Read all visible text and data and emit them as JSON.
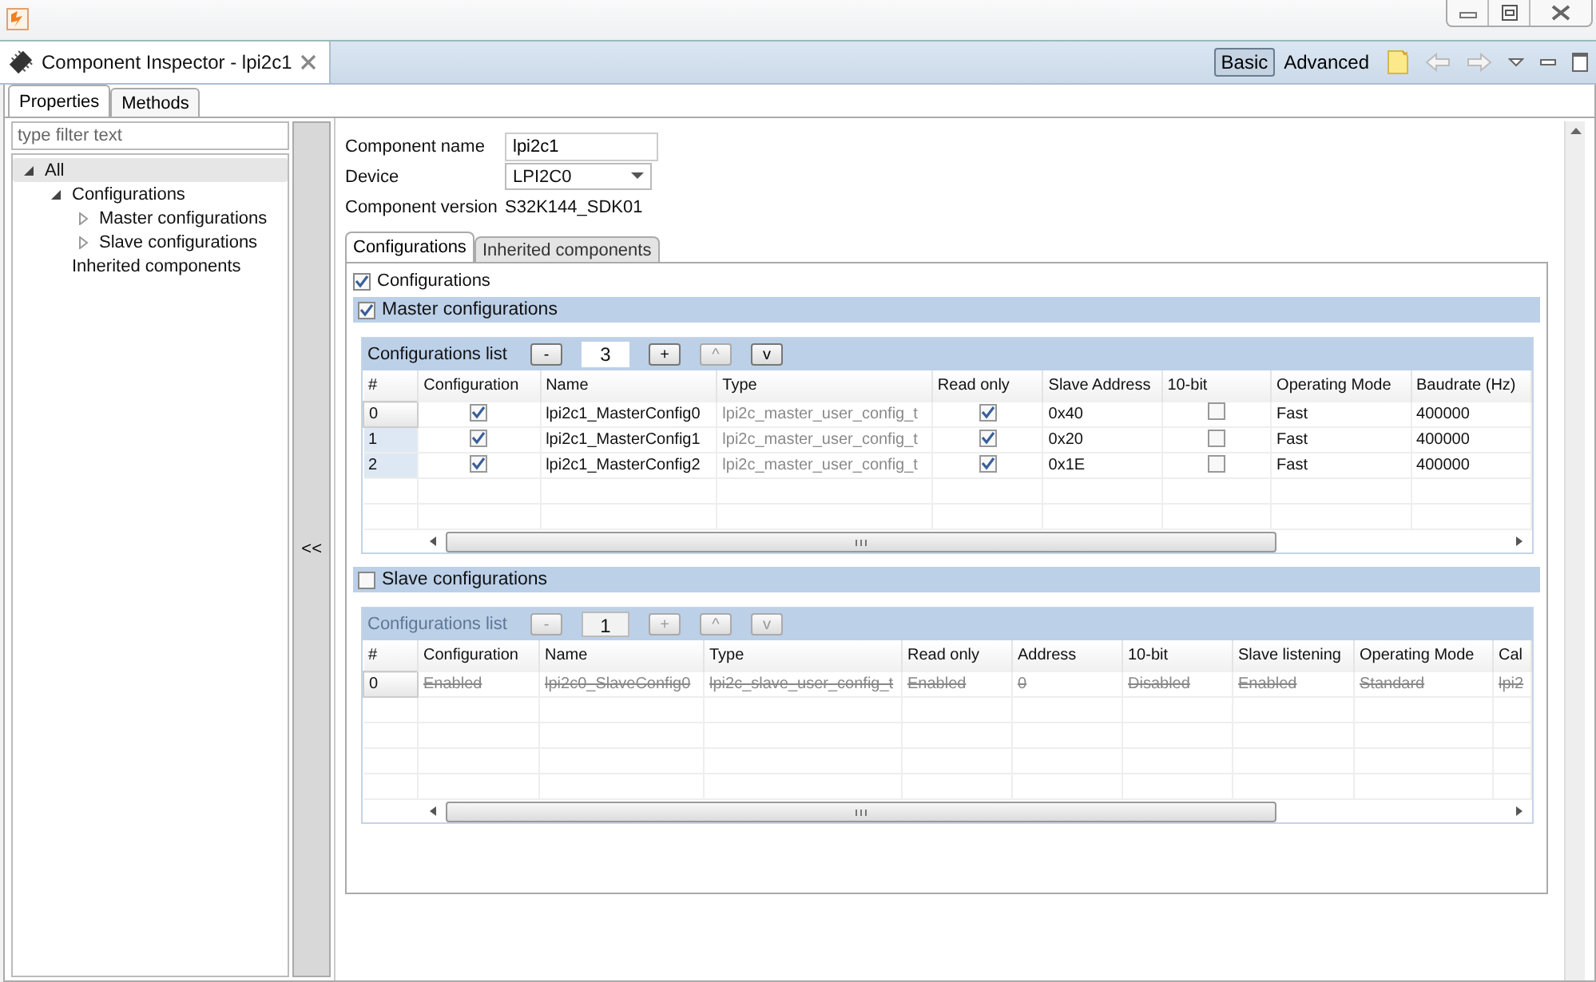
{
  "editor_tab": {
    "title": "Component Inspector - lpi2c1"
  },
  "view_modes": [
    {
      "label": "Basic",
      "selected": true
    },
    {
      "label": "Advanced",
      "selected": false
    }
  ],
  "side_tabs": [
    {
      "label": "Properties",
      "selected": true
    },
    {
      "label": "Methods",
      "selected": false
    }
  ],
  "filter": {
    "placeholder": "type filter text"
  },
  "tree": [
    {
      "label": "All",
      "expanded": true,
      "selected": true,
      "children": [
        {
          "label": "Configurations",
          "expanded": true,
          "selected": false,
          "children": [
            {
              "label": "Master configurations",
              "expanded": false,
              "selected": false
            },
            {
              "label": "Slave configurations",
              "expanded": false,
              "selected": false
            }
          ]
        },
        {
          "label": "Inherited components",
          "selected": false
        }
      ]
    }
  ],
  "collapse_button": "<<",
  "form": [
    {
      "kind": "input",
      "label": "Component name",
      "value": "lpi2c1"
    },
    {
      "kind": "dropdown",
      "label": "Device",
      "value": "LPI2C0"
    },
    {
      "kind": "text",
      "label": "Component version",
      "value": "S32K144_SDK01"
    }
  ],
  "inner_tabs": [
    {
      "label": "Configurations",
      "selected": true
    },
    {
      "label": "Inherited components",
      "selected": false
    }
  ],
  "configurations": {
    "label": "Configurations",
    "checked": true
  },
  "sections": [
    {
      "title": "Master configurations",
      "checked": true,
      "disabled": false,
      "list_label": "Configurations list",
      "count": "3",
      "buttons": [
        {
          "label": "-",
          "disabled": false
        },
        {
          "label": "+",
          "disabled": false
        },
        {
          "label": "^",
          "disabled": true
        },
        {
          "label": "v",
          "disabled": false
        }
      ],
      "columns": [
        "#",
        "Configuration",
        "Name",
        "Type",
        "Read only",
        "Slave Address",
        "10-bit",
        "Operating Mode",
        "Baudrate (Hz)"
      ],
      "rows": [
        [
          {
            "kind": "index",
            "value": "0"
          },
          {
            "kind": "check",
            "checked": true
          },
          {
            "kind": "text",
            "value": "lpi2c1_MasterConfig0"
          },
          {
            "kind": "dim",
            "value": "lpi2c_master_user_config_t"
          },
          {
            "kind": "check",
            "checked": true
          },
          {
            "kind": "text",
            "value": "0x40"
          },
          {
            "kind": "check",
            "checked": false
          },
          {
            "kind": "text",
            "value": "Fast"
          },
          {
            "kind": "text",
            "value": "400000"
          }
        ],
        [
          {
            "kind": "index",
            "value": "1"
          },
          {
            "kind": "check",
            "checked": true
          },
          {
            "kind": "text",
            "value": "lpi2c1_MasterConfig1"
          },
          {
            "kind": "dim",
            "value": "lpi2c_master_user_config_t"
          },
          {
            "kind": "check",
            "checked": true
          },
          {
            "kind": "text",
            "value": "0x20"
          },
          {
            "kind": "check",
            "checked": false
          },
          {
            "kind": "text",
            "value": "Fast"
          },
          {
            "kind": "text",
            "value": "400000"
          }
        ],
        [
          {
            "kind": "index",
            "value": "2"
          },
          {
            "kind": "check",
            "checked": true
          },
          {
            "kind": "text",
            "value": "lpi2c1_MasterConfig2"
          },
          {
            "kind": "dim",
            "value": "lpi2c_master_user_config_t"
          },
          {
            "kind": "check",
            "checked": true
          },
          {
            "kind": "text",
            "value": "0x1E"
          },
          {
            "kind": "check",
            "checked": false
          },
          {
            "kind": "text",
            "value": "Fast"
          },
          {
            "kind": "text",
            "value": "400000"
          }
        ]
      ]
    },
    {
      "title": "Slave configurations",
      "checked": false,
      "disabled": true,
      "list_label": "Configurations list",
      "count": "1",
      "buttons": [
        {
          "label": "-",
          "disabled": true
        },
        {
          "label": "+",
          "disabled": true
        },
        {
          "label": "^",
          "disabled": true
        },
        {
          "label": "v",
          "disabled": true
        }
      ],
      "columns": [
        "#",
        "Configuration",
        "Name",
        "Type",
        "Read only",
        "Address",
        "10-bit",
        "Slave listening",
        "Operating Mode",
        "Cal"
      ],
      "rows": [
        [
          {
            "kind": "index",
            "value": "0"
          },
          {
            "kind": "text",
            "value": "Enabled"
          },
          {
            "kind": "text",
            "value": "lpi2c0_SlaveConfig0"
          },
          {
            "kind": "text",
            "value": "lpi2c_slave_user_config_t"
          },
          {
            "kind": "text",
            "value": "Enabled"
          },
          {
            "kind": "text",
            "value": "0"
          },
          {
            "kind": "text",
            "value": "Disabled"
          },
          {
            "kind": "text",
            "value": "Enabled"
          },
          {
            "kind": "text",
            "value": "Standard"
          },
          {
            "kind": "text",
            "value": "lpi2"
          }
        ]
      ]
    }
  ]
}
